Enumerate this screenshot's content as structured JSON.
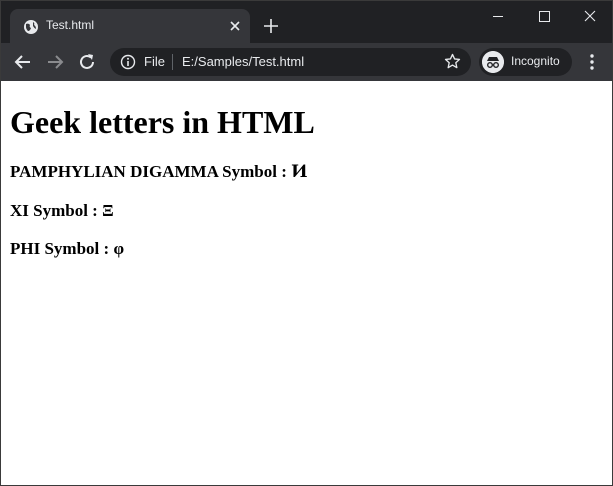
{
  "browser": {
    "tab": {
      "title": "Test.html",
      "favicon": "globe-icon"
    },
    "omnibox": {
      "scheme_label": "File",
      "url": "E:/Samples/Test.html"
    },
    "incognito_label": "Incognito"
  },
  "page": {
    "heading": "Geek letters in HTML",
    "symbols": [
      {
        "label": "PAMPHYLIAN DIGAMMA Symbol : ",
        "glyph": "Ͷ"
      },
      {
        "label": "XI Symbol : ",
        "glyph": "Ξ"
      },
      {
        "label": "PHI Symbol : ",
        "glyph": "φ"
      }
    ]
  },
  "colors": {
    "titlebar": "#202124",
    "toolbar": "#35363a",
    "text_light": "#e8eaed"
  }
}
